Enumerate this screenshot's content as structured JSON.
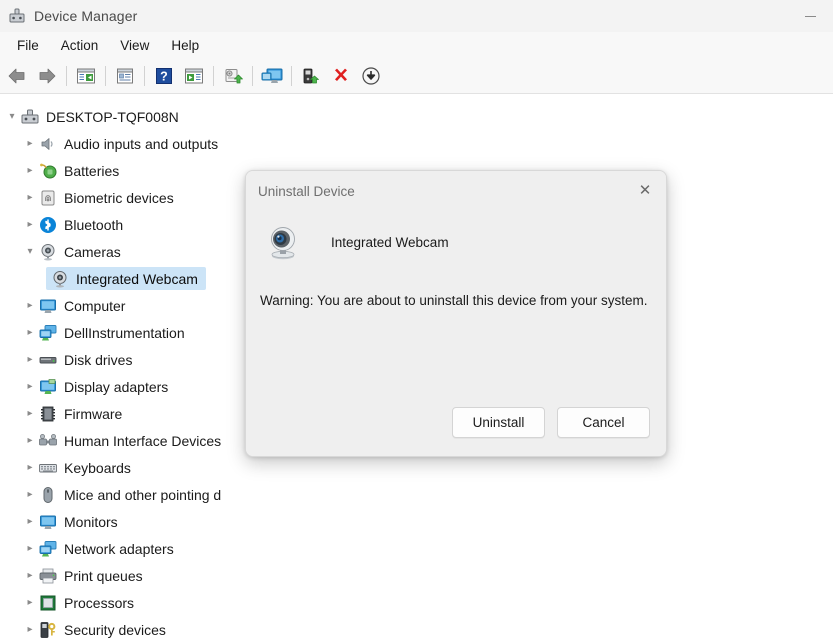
{
  "window": {
    "title": "Device Manager",
    "app_icon": "device-manager-icon",
    "minimize_label": "—"
  },
  "menubar": {
    "items": [
      {
        "label": "File"
      },
      {
        "label": "Action"
      },
      {
        "label": "View"
      },
      {
        "label": "Help"
      }
    ]
  },
  "toolbar": {
    "buttons": [
      {
        "icon": "back-arrow-icon",
        "title": "Back"
      },
      {
        "icon": "forward-arrow-icon",
        "title": "Forward"
      },
      {
        "icon": "show-hide-console-tree-icon",
        "title": "Show/Hide console tree"
      },
      {
        "icon": "properties-icon",
        "title": "Properties"
      },
      {
        "icon": "help-icon",
        "title": "Help"
      },
      {
        "icon": "show-hide-action-pane-icon",
        "title": "Show/Hide action pane"
      },
      {
        "icon": "update-driver-icon",
        "title": "Update driver"
      },
      {
        "icon": "scan-hardware-changes-icon",
        "title": "Scan for hardware changes"
      },
      {
        "icon": "enable-device-icon",
        "title": "Enable device"
      },
      {
        "icon": "uninstall-device-icon",
        "title": "Uninstall device"
      },
      {
        "icon": "disable-device-icon",
        "title": "Disable device"
      }
    ]
  },
  "tree": {
    "nodes": [
      {
        "label": "DESKTOP-TQF008N",
        "level": 0,
        "expander": "expanded",
        "icon": "computer-root-icon",
        "selected": false
      },
      {
        "label": "Audio inputs and outputs",
        "level": 1,
        "expander": "collapsed",
        "icon": "speaker-icon",
        "selected": false
      },
      {
        "label": "Batteries",
        "level": 1,
        "expander": "collapsed",
        "icon": "battery-icon",
        "selected": false
      },
      {
        "label": "Biometric devices",
        "level": 1,
        "expander": "collapsed",
        "icon": "fingerprint-icon",
        "selected": false
      },
      {
        "label": "Bluetooth",
        "level": 1,
        "expander": "collapsed",
        "icon": "bluetooth-icon",
        "selected": false
      },
      {
        "label": "Cameras",
        "level": 1,
        "expander": "expanded",
        "icon": "camera-icon",
        "selected": false
      },
      {
        "label": "Integrated Webcam",
        "level": 2,
        "expander": "none",
        "icon": "camera-icon",
        "selected": true
      },
      {
        "label": "Computer",
        "level": 1,
        "expander": "collapsed",
        "icon": "monitor-icon",
        "selected": false
      },
      {
        "label": "DellInstrumentation",
        "level": 1,
        "expander": "collapsed",
        "icon": "network-icon",
        "selected": false
      },
      {
        "label": "Disk drives",
        "level": 1,
        "expander": "collapsed",
        "icon": "disk-drive-icon",
        "selected": false
      },
      {
        "label": "Display adapters",
        "level": 1,
        "expander": "collapsed",
        "icon": "display-adapter-icon",
        "selected": false
      },
      {
        "label": "Firmware",
        "level": 1,
        "expander": "collapsed",
        "icon": "firmware-chip-icon",
        "selected": false
      },
      {
        "label": "Human Interface Devices",
        "level": 1,
        "expander": "collapsed",
        "icon": "hid-icon",
        "selected": false
      },
      {
        "label": "Keyboards",
        "level": 1,
        "expander": "collapsed",
        "icon": "keyboard-icon",
        "selected": false
      },
      {
        "label": "Mice and other pointing d",
        "level": 1,
        "expander": "collapsed",
        "icon": "mouse-icon",
        "selected": false
      },
      {
        "label": "Monitors",
        "level": 1,
        "expander": "collapsed",
        "icon": "monitor-icon",
        "selected": false
      },
      {
        "label": "Network adapters",
        "level": 1,
        "expander": "collapsed",
        "icon": "network-icon",
        "selected": false
      },
      {
        "label": "Print queues",
        "level": 1,
        "expander": "collapsed",
        "icon": "printer-icon",
        "selected": false
      },
      {
        "label": "Processors",
        "level": 1,
        "expander": "collapsed",
        "icon": "processor-icon",
        "selected": false
      },
      {
        "label": "Security devices",
        "level": 1,
        "expander": "collapsed",
        "icon": "security-key-icon",
        "selected": false
      }
    ]
  },
  "dialog": {
    "title": "Uninstall Device",
    "close_icon": "close-icon",
    "close_glyph": "✕",
    "device_icon": "webcam-icon",
    "device_name": "Integrated Webcam",
    "warning": "Warning: You are about to uninstall this device from your system.",
    "buttons": [
      {
        "label": "Uninstall",
        "name": "uninstall-button"
      },
      {
        "label": "Cancel",
        "name": "cancel-button"
      }
    ]
  },
  "colors": {
    "selection": "#cce4f7",
    "titlebar": "#f3f3f3",
    "toolbar": "#f8f8f8",
    "dialog_bg": "#efefef",
    "accent_blue": "#0a84d8",
    "error_red": "#e01b24",
    "green": "#3fa535"
  }
}
